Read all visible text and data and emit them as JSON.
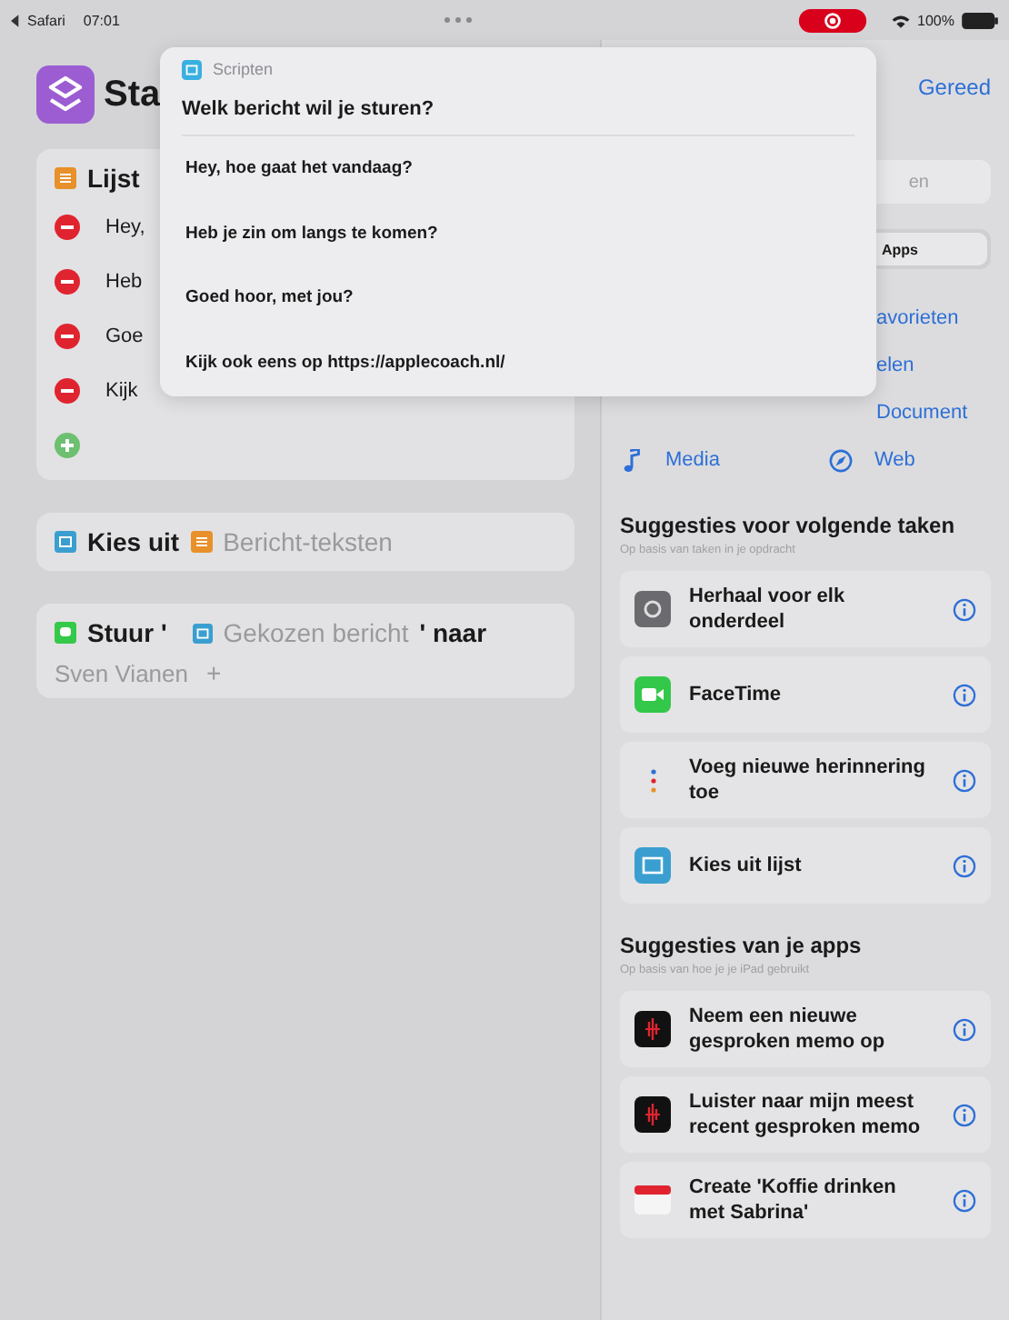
{
  "status_bar": {
    "back_app": "Safari",
    "time": "07:01",
    "battery": "100%"
  },
  "header": {
    "title": "Sta",
    "done": "Gereed"
  },
  "list_action": {
    "title": "Lijst",
    "items": [
      {
        "text": "Hey,"
      },
      {
        "text": "Heb"
      },
      {
        "text": "Goe"
      },
      {
        "text": "Kijk"
      }
    ]
  },
  "choose_action": {
    "label": "Kies uit",
    "variable": "Bericht-teksten"
  },
  "send_action": {
    "label": "Stuur '",
    "variable": "Gekozen bericht",
    "suffix": "' naar",
    "recipient": "Sven Vianen",
    "add": "+"
  },
  "sidebar": {
    "search_fragment": "en",
    "segment": "Apps",
    "categories": [
      {
        "label": "avorieten",
        "kind": "none"
      },
      {
        "label": "elen",
        "kind": "none"
      },
      {
        "label": "Document",
        "kind": "none"
      },
      {
        "label": "Media",
        "kind": "music"
      },
      {
        "label": "Web",
        "kind": "compass"
      }
    ],
    "sections": [
      {
        "title": "Suggesties voor volgende taken",
        "subtitle": "Op basis van taken in je opdracht",
        "items": [
          {
            "label": "Herhaal voor elk onderdeel",
            "kind": "repeat"
          },
          {
            "label": "FaceTime",
            "kind": "facetime"
          },
          {
            "label": "Voeg nieuwe herinnering toe",
            "kind": "reminder"
          },
          {
            "label": "Kies uit lijst",
            "kind": "list"
          }
        ]
      },
      {
        "title": "Suggesties van je apps",
        "subtitle": "Op basis van hoe je je iPad gebruikt",
        "items": [
          {
            "label": "Neem een nieuwe gesproken memo op",
            "kind": "memo"
          },
          {
            "label": "Luister naar mijn meest recent gesproken memo",
            "kind": "memo"
          },
          {
            "label": "Create 'Koffie drinken met Sabrina'",
            "kind": "calendar"
          }
        ]
      }
    ]
  },
  "popup": {
    "app": "Scripten",
    "title": "Welk bericht wil je sturen?",
    "options": [
      {
        "text": "Hey, hoe gaat het vandaag?"
      },
      {
        "text": "Heb je zin om langs te komen?"
      },
      {
        "text": "Goed hoor, met jou?"
      },
      {
        "text": "Kijk ook eens op https://applecoach.nl/"
      }
    ]
  }
}
